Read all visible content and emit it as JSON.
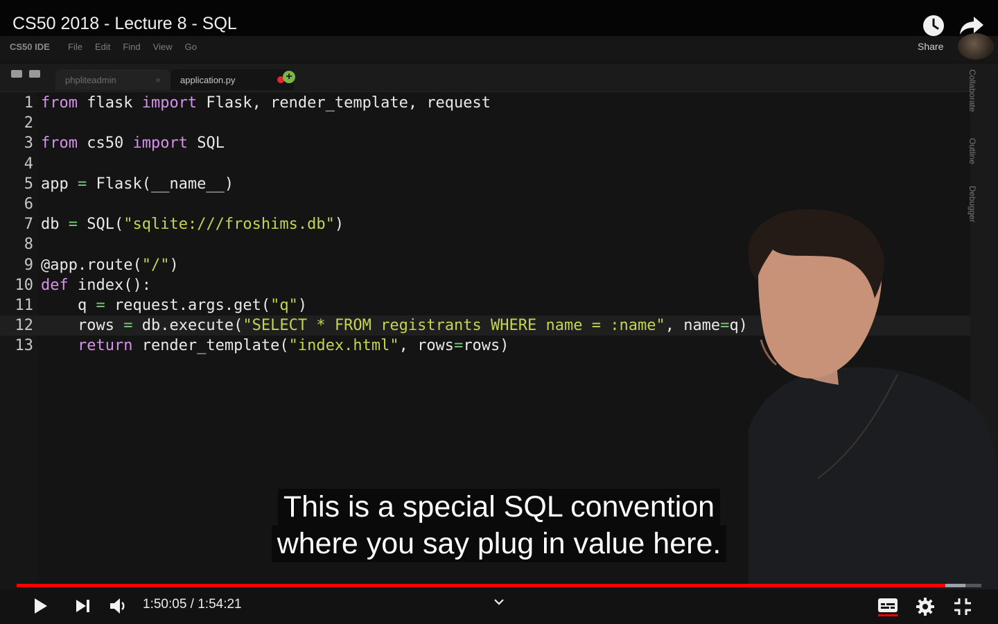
{
  "video": {
    "title": "CS50 2018 - Lecture 8 - SQL",
    "share_label": "Share"
  },
  "ide": {
    "brand": "CS50 IDE",
    "menu": [
      "File",
      "Edit",
      "Find",
      "View",
      "Go"
    ],
    "tabs": [
      {
        "label": "phpliteadmin",
        "active": false
      },
      {
        "label": "application.py",
        "active": true,
        "unsaved": true
      }
    ],
    "side_panels": [
      "Collaborate",
      "Outline",
      "Debugger"
    ],
    "code_lines": [
      [
        [
          "kw",
          "from"
        ],
        [
          "t",
          " flask "
        ],
        [
          "kw",
          "import"
        ],
        [
          "t",
          " Flask, render_template, request"
        ]
      ],
      [],
      [
        [
          "kw",
          "from"
        ],
        [
          "t",
          " cs50 "
        ],
        [
          "kw",
          "import"
        ],
        [
          "t",
          " SQL"
        ]
      ],
      [],
      [
        [
          "t",
          "app "
        ],
        [
          "op",
          "="
        ],
        [
          "t",
          " Flask(__name__)"
        ]
      ],
      [],
      [
        [
          "t",
          "db "
        ],
        [
          "op",
          "="
        ],
        [
          "t",
          " SQL("
        ],
        [
          "str",
          "\"sqlite:///froshims.db\""
        ],
        [
          "t",
          ")"
        ]
      ],
      [],
      [
        [
          "t",
          "@app.route("
        ],
        [
          "str",
          "\"/\""
        ],
        [
          "t",
          ")"
        ]
      ],
      [
        [
          "kw",
          "def"
        ],
        [
          "t",
          " index():"
        ]
      ],
      [
        [
          "t",
          "    q "
        ],
        [
          "op",
          "="
        ],
        [
          "t",
          " request.args.get("
        ],
        [
          "str",
          "\"q\""
        ],
        [
          "t",
          ")"
        ]
      ],
      [
        [
          "t",
          "    rows "
        ],
        [
          "op",
          "="
        ],
        [
          "t",
          " db.execute("
        ],
        [
          "str",
          "\"SELECT * FROM registrants WHERE name = :name\""
        ],
        [
          "t",
          ", name"
        ],
        [
          "op",
          "="
        ],
        [
          "t",
          "q)"
        ]
      ],
      [
        [
          "kw",
          "    return"
        ],
        [
          "t",
          " render_template("
        ],
        [
          "str",
          "\"index.html\""
        ],
        [
          "t",
          ", rows"
        ],
        [
          "op",
          "="
        ],
        [
          "t",
          "rows)"
        ]
      ]
    ],
    "active_line": 12
  },
  "subtitles": [
    "This is a special SQL convention",
    "where you say plug in value here."
  ],
  "player": {
    "time_display": "1:50:05 / 1:54:21",
    "progress_fraction": 0.9627,
    "buffered_fraction": 0.9835,
    "accent": "#ff0000"
  },
  "icons": {
    "play": "play-icon",
    "next": "skip-next-icon",
    "volume": "volume-icon",
    "captions": "captions-icon",
    "settings": "gear-icon",
    "fullscreen": "exit-fullscreen-icon",
    "watch_later": "clock-icon",
    "share": "share-arrow-icon"
  }
}
